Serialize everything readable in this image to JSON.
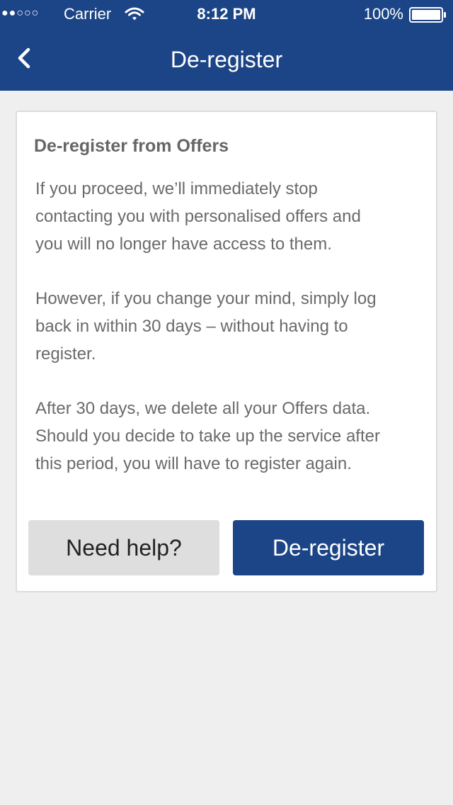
{
  "status_bar": {
    "signal": "●●○○○",
    "carrier": "Carrier",
    "time": "8:12 PM",
    "battery_percent": "100%"
  },
  "nav": {
    "title": "De-register",
    "back_icon": "chevron-left-icon"
  },
  "card": {
    "heading": "De-register from  Offers",
    "paragraphs": [
      "If you proceed, we’ll immediately stop\ncontacting you with personalised offers and\nyou will no longer have access to them.",
      "However, if you change your mind, simply log\nback in within 30 days – without having to\nregister.",
      "After 30 days, we delete all your  Offers data.\nShould you decide to take up the service after\nthis period, you will have to register again."
    ],
    "help_button": "Need help?",
    "deregister_button": "De-register"
  },
  "colors": {
    "brand": "#1c4587",
    "background": "#efeff0",
    "secondary_button": "#dedede",
    "body_text": "#6a6a6a"
  }
}
